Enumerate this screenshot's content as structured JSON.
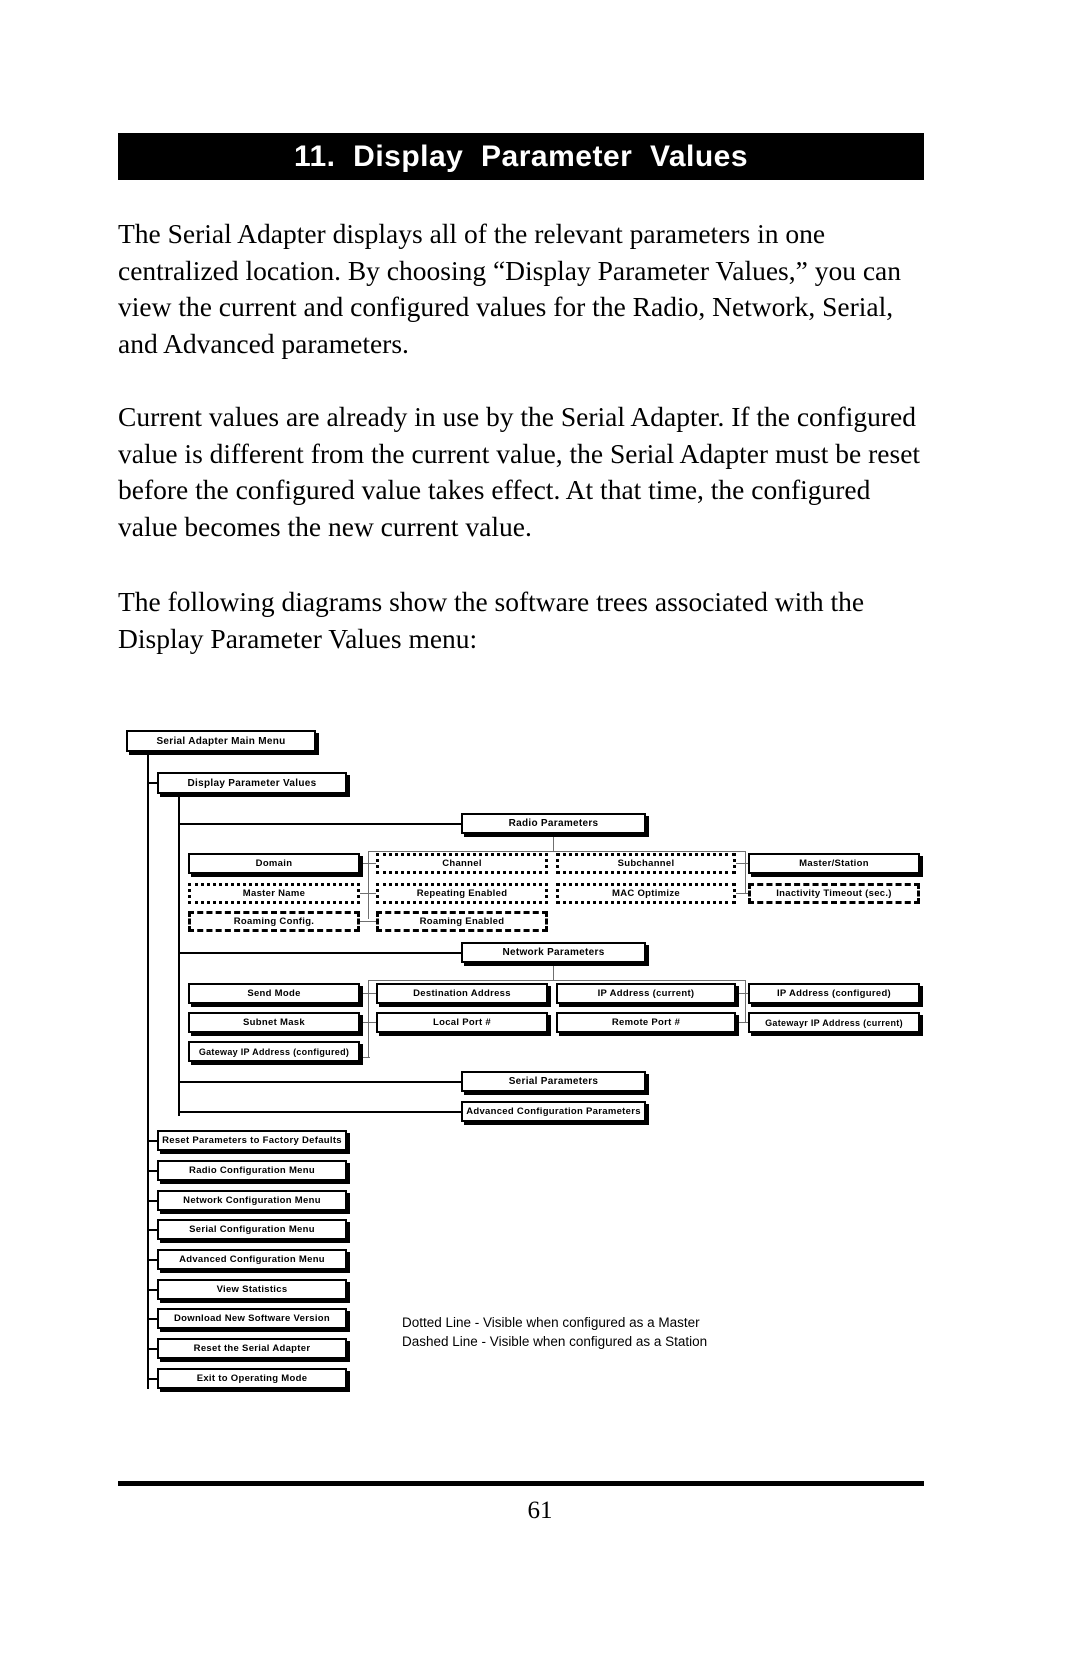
{
  "document": {
    "chapter_title": "11.  Display  Parameter  Values",
    "paragraphs": {
      "p1": "The Serial Adapter displays all of the relevant parameters in one centralized location.  By choosing “Display Parameter Values,” you can view the current and configured values for the Radio, Network, Serial, and Advanced parameters.",
      "p2": "Current values are already in use by the Serial Adapter.  If the configured value is different from the current value, the Serial Adapter must be reset before the configured value takes effect.  At that time, the configured value becomes the new current value.",
      "p3": "The following diagrams show the software trees associated with the Display Parameter Values menu:"
    },
    "page_number": "61"
  },
  "diagram": {
    "root": "Serial Adapter Main Menu",
    "display_parameter_values": "Display Parameter Values",
    "radio": {
      "header": "Radio Parameters",
      "domain": "Domain",
      "channel": "Channel",
      "subchannel": "Subchannel",
      "master_station": "Master/Station",
      "master_name": "Master Name",
      "repeating_enabled": "Repeating Enabled",
      "mac_optimize": "MAC Optimize",
      "inactivity_timeout": "Inactivity Timeout (sec.)",
      "roaming_config": "Roaming Config.",
      "roaming_enabled": "Roaming Enabled"
    },
    "network": {
      "header": "Network Parameters",
      "send_mode": "Send Mode",
      "destination_address": "Destination Address",
      "ip_address_current": "IP Address (current)",
      "ip_address_configured": "IP Address (configured)",
      "subnet_mask": "Subnet Mask",
      "local_port": "Local  Port #",
      "remote_port": "Remote Port #",
      "gateway_ip_current": "Gatewayr IP Address (current)",
      "gateway_ip_configured": "Gateway IP Address (configured)"
    },
    "serial_parameters": "Serial Parameters",
    "advanced_configuration_parameters": "Advanced Configuration Parameters",
    "main_menu_items": [
      "Reset Parameters to Factory Defaults",
      "Radio Configuration Menu",
      "Network Configuration Menu",
      "Serial Configuration Menu",
      "Advanced Configuration Menu",
      "View Statistics",
      "Download New Software Version",
      "Reset the Serial Adapter",
      "Exit to Operating Mode"
    ],
    "legend": "Dotted Line - Visible when configured as a Master\nDashed Line - Visible when configured as a Station"
  }
}
